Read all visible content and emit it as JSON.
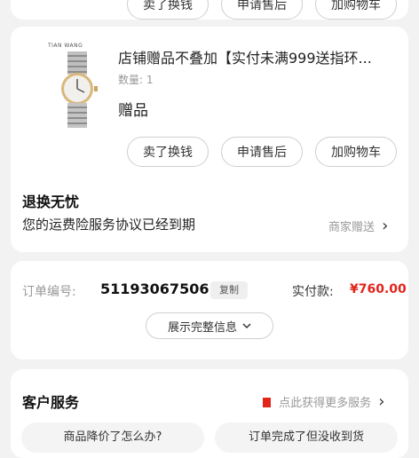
{
  "top_actions": [
    "卖了换钱",
    "申请售后",
    "加购物车"
  ],
  "product": {
    "title": "店铺赠品不叠加【实付未满999送指环...",
    "quantity": "数量: 1",
    "tag": "赠品",
    "brand_mark": "TIAN WANG",
    "actions": [
      "卖了换钱",
      "申请售后",
      "加购物车"
    ]
  },
  "return_info": {
    "title": "退换无忧",
    "desc": "您的运费险服务协议已经到期",
    "right": "商家赠送",
    "arrow": "›"
  },
  "order": {
    "number_label": "订单编号:",
    "number": "51193067506",
    "copy": "复制",
    "paid_label": "实付款:",
    "paid_amount": "¥760.00",
    "expand": "展示完整信息",
    "expand_icon": "chevron-down"
  },
  "service": {
    "title": "客户服务",
    "right": "点此获得更多服务",
    "arrow": "›",
    "q1": "商品降价了怎么办?",
    "q2": "订单完成了但没收到货"
  },
  "colors": {
    "price": "#e1251b",
    "accent": "#e1251b"
  }
}
